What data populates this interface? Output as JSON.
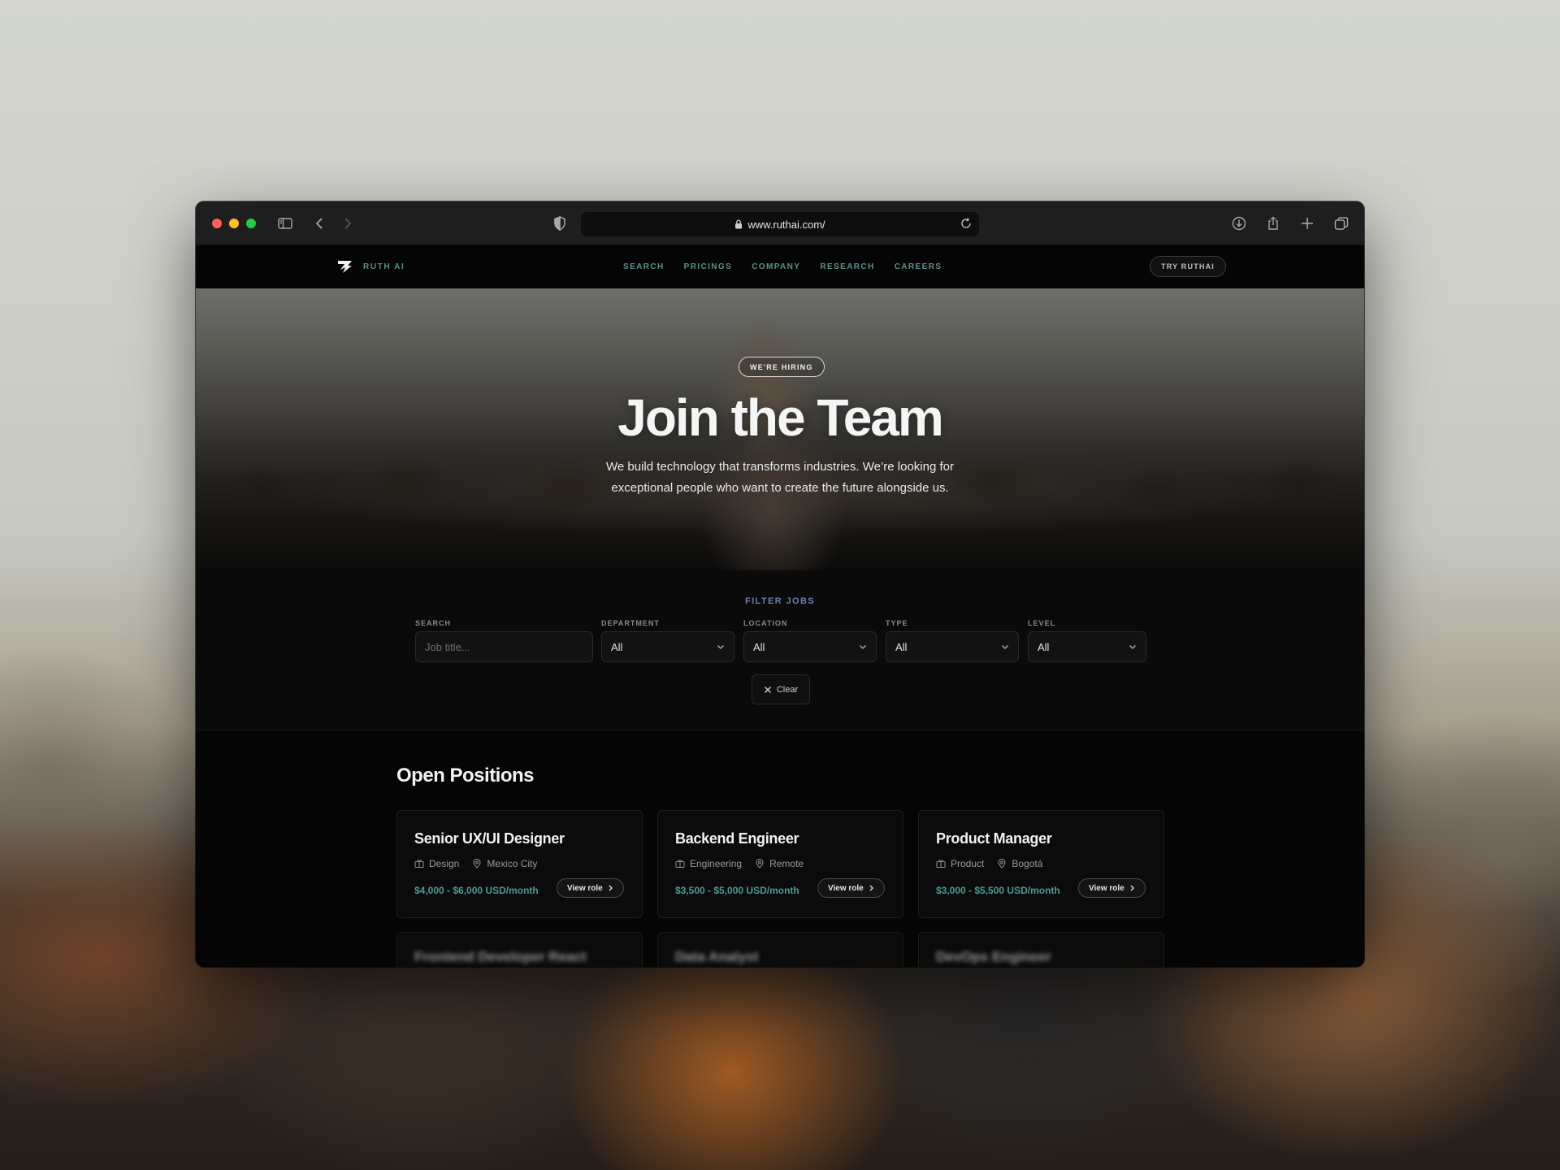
{
  "browser": {
    "url": "www.ruthai.com/"
  },
  "site": {
    "brand": "RUTH AI",
    "nav": [
      {
        "label": "SEARCH"
      },
      {
        "label": "PRICINGS"
      },
      {
        "label": "COMPANY"
      },
      {
        "label": "RESEARCH"
      },
      {
        "label": "CAREERS"
      }
    ],
    "cta": "TRY RUTHAI"
  },
  "hero": {
    "badge": "WE'RE HIRING",
    "title": "Join the Team",
    "subtitle_line1": "We build technology that transforms industries. We’re looking for",
    "subtitle_line2": "exceptional people who want to create the future alongside us."
  },
  "filters": {
    "title": "FILTER JOBS",
    "search": {
      "label": "SEARCH",
      "placeholder": "Job title..."
    },
    "department": {
      "label": "DEPARTMENT",
      "value": "All"
    },
    "location": {
      "label": "LOCATION",
      "value": "All"
    },
    "type": {
      "label": "TYPE",
      "value": "All"
    },
    "level": {
      "label": "LEVEL",
      "value": "All"
    },
    "clear_label": "Clear"
  },
  "positions": {
    "title": "Open Positions",
    "view_label": "View role",
    "cards": [
      {
        "title": "Senior UX/UI Designer",
        "department": "Design",
        "location": "Mexico City",
        "salary": "$4,000 - $6,000 USD/month"
      },
      {
        "title": "Backend Engineer",
        "department": "Engineering",
        "location": "Remote",
        "salary": "$3,500 - $5,000 USD/month"
      },
      {
        "title": "Product Manager",
        "department": "Product",
        "location": "Bogotá",
        "salary": "$3,000 - $5,500 USD/month"
      }
    ],
    "more": [
      {
        "title": "Frontend Developer React"
      },
      {
        "title": "Data Analyst"
      },
      {
        "title": "DevOps Engineer"
      }
    ]
  },
  "colors": {
    "accent_teal": "#4f9a92",
    "filter_title": "#6b7fb3",
    "background": "#050505"
  }
}
